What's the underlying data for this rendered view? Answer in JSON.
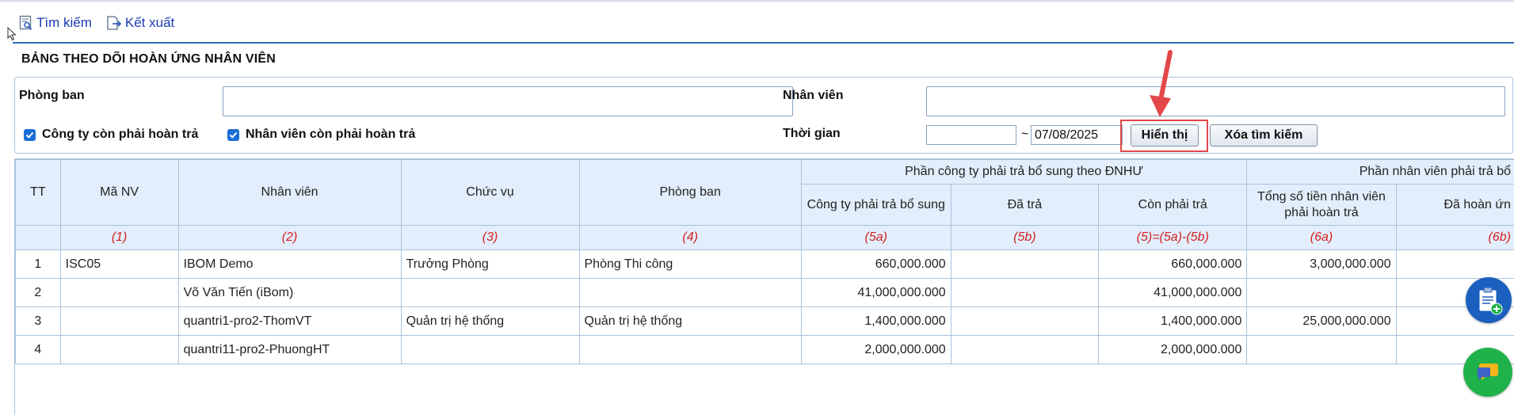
{
  "toolbar": {
    "search_label": "Tìm kiếm",
    "export_label": "Kết xuất"
  },
  "page_title": "BẢNG THEO DÕI HOÀN ỨNG NHÂN VIÊN",
  "filters": {
    "department_label": "Phòng ban",
    "department_value": "",
    "employee_label": "Nhân viên",
    "employee_value": "",
    "company_owes_label": "Công ty còn phải hoàn trả",
    "employee_owes_label": "Nhân viên còn phải hoàn trả",
    "time_label": "Thời gian",
    "date_from": "",
    "date_separator": "~",
    "date_to": "07/08/2025",
    "show_button": "Hiển thị",
    "clear_button": "Xóa tìm kiếm"
  },
  "table": {
    "headers": {
      "tt": "TT",
      "emp_code": "Mã NV",
      "employee": "Nhân viên",
      "position": "Chức vụ",
      "department": "Phòng ban",
      "company_group": "Phần công ty phải trả bổ sung theo ĐNHƯ",
      "company_extra": "Công ty phải trả bổ sung",
      "paid": "Đã trả",
      "remaining": "Còn phải trả",
      "employee_group": "Phần nhân viên phải trả bổ",
      "employee_total": "Tổng số tiền nhân viên phải hoàn trả",
      "refunded": "Đã hoàn ứn"
    },
    "index_row": [
      "(1)",
      "(2)",
      "(3)",
      "(4)",
      "(5a)",
      "(5b)",
      "(5)=(5a)-(5b)",
      "(6a)",
      "(6b)"
    ],
    "rows": [
      {
        "tt": "1",
        "code": "ISC05",
        "name": "IBOM Demo",
        "position": "Trưởng Phòng",
        "department": "Phòng Thi công",
        "company_extra": "660,000.000",
        "paid": "",
        "remaining": "660,000.000",
        "employee_total": "3,000,000.000",
        "refunded": ""
      },
      {
        "tt": "2",
        "code": "",
        "name": "Võ Văn Tiến (iBom)",
        "position": "",
        "department": "",
        "company_extra": "41,000,000.000",
        "paid": "",
        "remaining": "41,000,000.000",
        "employee_total": "",
        "refunded": ""
      },
      {
        "tt": "3",
        "code": "",
        "name": "quantri1-pro2-ThomVT",
        "position": "Quản trị hệ thống",
        "department": "Quản trị hệ thống",
        "company_extra": "1,400,000.000",
        "paid": "",
        "remaining": "1,400,000.000",
        "employee_total": "25,000,000.000",
        "refunded": ""
      },
      {
        "tt": "4",
        "code": "",
        "name": "quantri11-pro2-PhuongHT",
        "position": "",
        "department": "",
        "company_extra": "2,000,000.000",
        "paid": "",
        "remaining": "2,000,000.000",
        "employee_total": "",
        "refunded": ""
      }
    ]
  },
  "colors": {
    "link": "#2a56b5",
    "header_bg": "#e2eefb",
    "index_text": "#d42020",
    "highlight": "#e4474a",
    "fab_blue": "#1b5fbf",
    "fab_green": "#20b24a"
  }
}
